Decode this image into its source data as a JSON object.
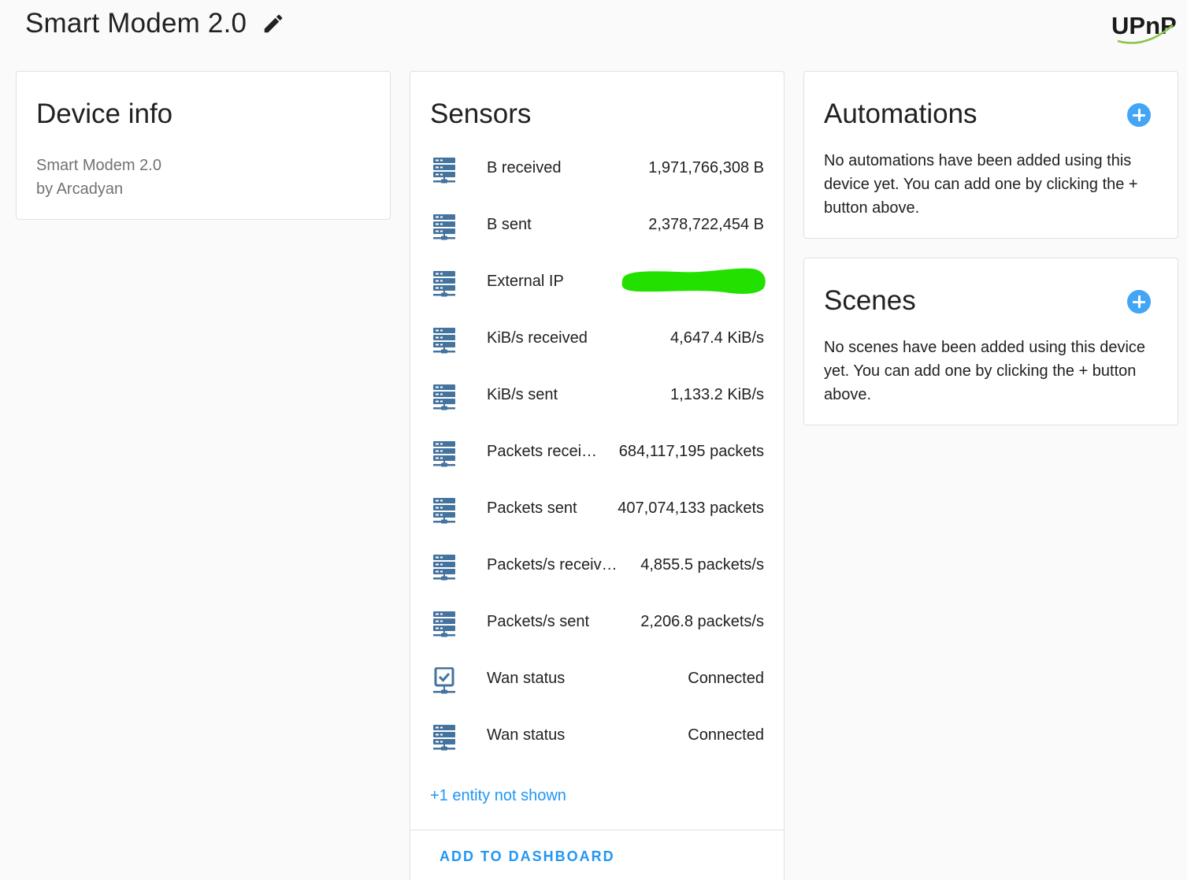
{
  "header": {
    "title": "Smart Modem 2.0",
    "edit_icon": "pencil-icon",
    "logo_text": "UPnP"
  },
  "device_info": {
    "title": "Device info",
    "model": "Smart Modem 2.0",
    "manufacturer": "by Arcadyan"
  },
  "sensors": {
    "title": "Sensors",
    "items": [
      {
        "name": "B received",
        "value": "1,971,766,308 B",
        "icon": "server-network-icon"
      },
      {
        "name": "B sent",
        "value": "2,378,722,454 B",
        "icon": "server-network-icon"
      },
      {
        "name": "External IP",
        "value": "",
        "icon": "server-network-icon"
      },
      {
        "name": "KiB/s received",
        "value": "4,647.4 KiB/s",
        "icon": "server-network-icon"
      },
      {
        "name": "KiB/s sent",
        "value": "1,133.2 KiB/s",
        "icon": "server-network-icon"
      },
      {
        "name": "Packets recei…",
        "value": "684,117,195 packets",
        "icon": "server-network-icon"
      },
      {
        "name": "Packets sent",
        "value": "407,074,133 packets",
        "icon": "server-network-icon"
      },
      {
        "name": "Packets/s receiv…",
        "value": "4,855.5 packets/s",
        "icon": "server-network-icon"
      },
      {
        "name": "Packets/s sent",
        "value": "2,206.8 packets/s",
        "icon": "server-network-icon"
      },
      {
        "name": "Wan status",
        "value": "Connected",
        "icon": "checkbox-network-icon"
      },
      {
        "name": "Wan status",
        "value": "Connected",
        "icon": "server-network-icon"
      }
    ],
    "more_link": "+1 entity not shown",
    "add_dashboard": "ADD TO DASHBOARD"
  },
  "automations": {
    "title": "Automations",
    "empty_text": "No automations have been added using this device yet. You can add one by clicking the + button above."
  },
  "scenes": {
    "title": "Scenes",
    "empty_text": "No scenes have been added using this device yet. You can add one by clicking the + button above."
  },
  "colors": {
    "accent": "#2196f3",
    "icon": "#44739e",
    "redaction": "#22e000",
    "logo_green": "#8bc34a"
  }
}
